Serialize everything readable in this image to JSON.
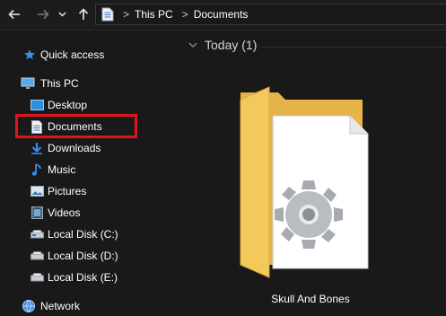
{
  "toolbar": {
    "back_icon": "arrow-left-icon",
    "forward_icon": "arrow-right-icon",
    "recent_icon": "chevron-down-icon",
    "up_icon": "arrow-up-icon"
  },
  "address": {
    "icon": "document-icon",
    "crumbs": [
      "This PC",
      "Documents"
    ]
  },
  "sidebar": {
    "items": [
      {
        "label": "Quick access",
        "icon": "star-icon"
      },
      {
        "label": "This PC",
        "icon": "computer-icon"
      },
      {
        "label": "Desktop",
        "icon": "desktop-icon"
      },
      {
        "label": "Documents",
        "icon": "documents-icon",
        "selected": true
      },
      {
        "label": "Downloads",
        "icon": "download-icon"
      },
      {
        "label": "Music",
        "icon": "music-icon"
      },
      {
        "label": "Pictures",
        "icon": "pictures-icon"
      },
      {
        "label": "Videos",
        "icon": "videos-icon"
      },
      {
        "label": "Local Disk (C:)",
        "icon": "drive-icon"
      },
      {
        "label": "Local Disk (D:)",
        "icon": "drive-icon"
      },
      {
        "label": "Local Disk (E:)",
        "icon": "drive-icon"
      },
      {
        "label": "Network",
        "icon": "network-icon"
      }
    ]
  },
  "content": {
    "group_title": "Today (1)",
    "files": [
      {
        "name": "Skull And Bones",
        "icon": "folder-with-gear-icon"
      }
    ]
  },
  "colors": {
    "background": "#191919",
    "highlight_border": "#e0141c",
    "folder": "#f3c95c"
  }
}
